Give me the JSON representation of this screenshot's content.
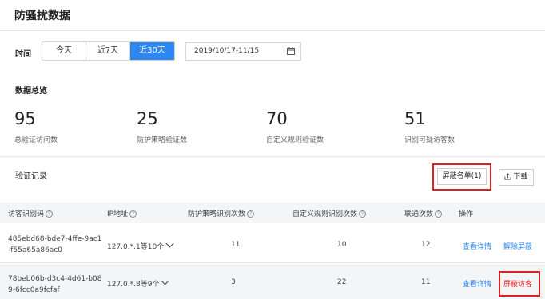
{
  "page": {
    "title": "防骚扰数据"
  },
  "filter": {
    "time_label": "时间",
    "ranges": [
      "今天",
      "近7天",
      "近30天"
    ],
    "active_range": "近30天",
    "date_range": "2019/10/17-11/15"
  },
  "overview": {
    "title": "数据总览",
    "stats": [
      {
        "value": "95",
        "label": "总验证访问数"
      },
      {
        "value": "25",
        "label": "防护策略验证数"
      },
      {
        "value": "70",
        "label": "自定义规则验证数"
      },
      {
        "value": "51",
        "label": "识别可疑访客数"
      }
    ]
  },
  "records": {
    "title": "验证记录",
    "block_list_button": "屏蔽名单(1)",
    "download_button": "下载",
    "columns": [
      "访客识别码",
      "IP地址",
      "防护策略识别次数",
      "自定义规则识别次数",
      "联通次数",
      "操作"
    ],
    "rows": [
      {
        "visitor_code": "485ebd68-bde7-4ffe-9ac1-f55a65a86ac0",
        "ip": "127.0.*.1等10个",
        "strategy_count": "11",
        "rule_count": "10",
        "connect_count": "12",
        "action_detail": "查看详情",
        "action_block": "解除屏蔽"
      },
      {
        "visitor_code": "78beb06b-d3c4-4d61-b089-6fcc0a9fcfaf",
        "ip": "127.0.*.8等9个",
        "strategy_count": "3",
        "rule_count": "22",
        "connect_count": "11",
        "action_detail": "查看详情",
        "action_block": "屏蔽访客"
      }
    ]
  },
  "colors": {
    "primary": "#2e87f0",
    "highlight": "#e02020"
  }
}
